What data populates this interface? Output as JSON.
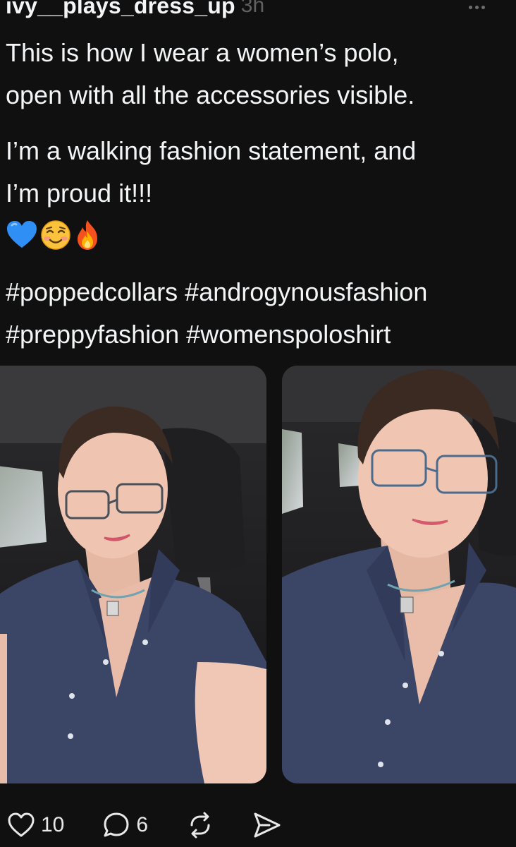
{
  "post": {
    "username": "ivy__plays_dress_up",
    "timestamp": "3h",
    "paragraph_1": [
      "This is how I wear a women’s polo,",
      "open with all the accessories visible."
    ],
    "paragraph_2": [
      "I’m a walking fashion statement, and",
      "I’m proud it!!!"
    ],
    "emojis": [
      "blue-heart",
      "smiling-face-blush",
      "fire"
    ],
    "hashtags": [
      "#poppedcollars #androgynousfashion",
      "#preppyfashion #womenspoloshirt"
    ],
    "images": [
      "selfie-in-car-navy-polo-left",
      "selfie-in-car-navy-polo-right"
    ]
  },
  "actions": {
    "like_icon": "heart-outline-icon",
    "like_count": "10",
    "reply_icon": "speech-bubble-icon",
    "reply_count": "6",
    "repost_icon": "repost-arrows-icon",
    "share_icon": "send-paper-plane-icon"
  },
  "colors": {
    "background": "#101010",
    "text": "#f3f5f7",
    "muted": "#616161",
    "polo_navy": "#3b4566"
  }
}
